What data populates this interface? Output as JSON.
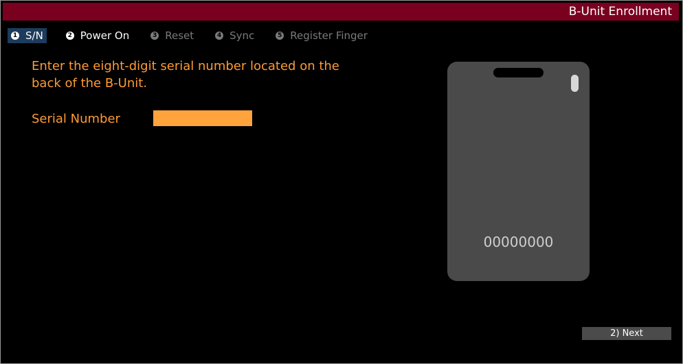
{
  "window": {
    "title": "B-Unit Enrollment"
  },
  "steps": [
    {
      "number": "1",
      "label": "S/N"
    },
    {
      "number": "2",
      "label": "Power On"
    },
    {
      "number": "3",
      "label": "Reset"
    },
    {
      "number": "4",
      "label": "Sync"
    },
    {
      "number": "5",
      "label": "Register Finger"
    }
  ],
  "instruction": "Enter the eight-digit serial number located on the back of the B-Unit.",
  "form": {
    "serial_label": "Serial Number",
    "serial_value": ""
  },
  "device": {
    "serial_display": "00000000"
  },
  "footer": {
    "next_label": "2) Next"
  },
  "colors": {
    "title_bar": "#7a0020",
    "accent_text": "#ff9b34",
    "input_fill": "#ffa33c",
    "active_step": "#1d3b5c",
    "device_body": "#4a4a4a"
  }
}
